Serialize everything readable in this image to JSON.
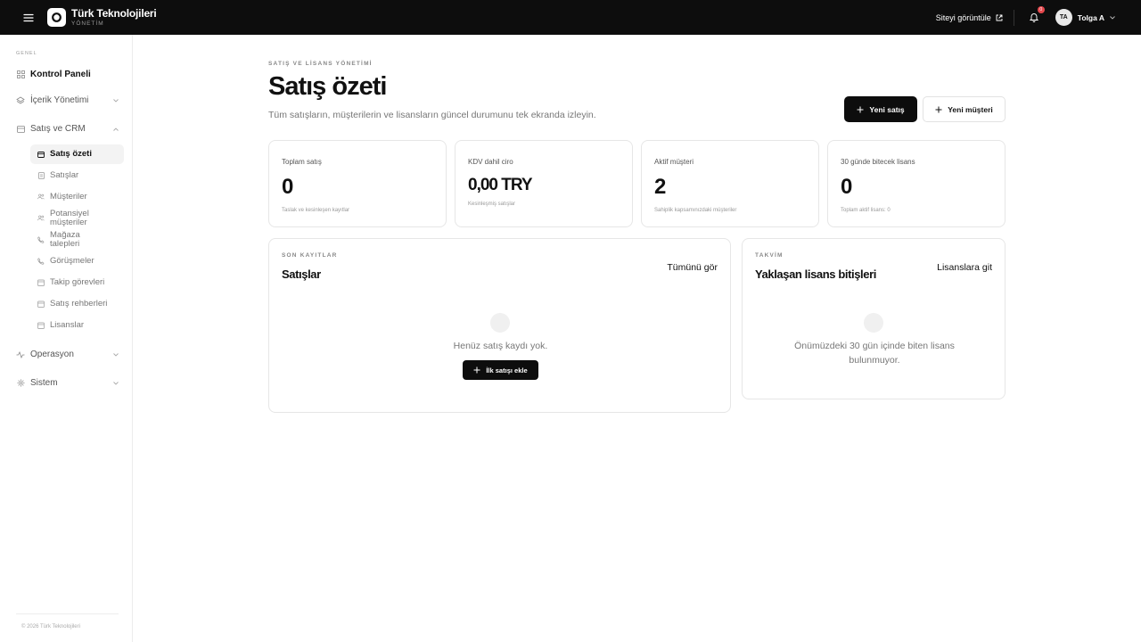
{
  "topbar": {
    "brand_name": "Türk Teknolojileri",
    "brand_sub": "YÖNETİM",
    "view_site": "Siteyi görüntüle",
    "notifications_count": "0",
    "user_initials": "TA",
    "user_name": "Tolga A"
  },
  "sidebar": {
    "section_label": "GENEL",
    "items": [
      {
        "label": "Kontrol Paneli",
        "icon": "grid-icon"
      },
      {
        "label": "İçerik Yönetimi",
        "icon": "layers-icon"
      },
      {
        "label": "Satış ve CRM",
        "icon": "wallet-icon"
      },
      {
        "label": "Operasyon",
        "icon": "activity-icon"
      },
      {
        "label": "Sistem",
        "icon": "gear-icon"
      }
    ],
    "sub_items": [
      {
        "label": "Satış özeti"
      },
      {
        "label": "Satışlar"
      },
      {
        "label": "Müşteriler"
      },
      {
        "label": "Potansiyel müşteriler"
      },
      {
        "label": "Mağaza talepleri"
      },
      {
        "label": "Görüşmeler"
      },
      {
        "label": "Takip görevleri"
      },
      {
        "label": "Satış rehberleri"
      },
      {
        "label": "Lisanslar"
      }
    ],
    "footer": "© 2026 Türk Teknolojileri"
  },
  "header": {
    "eyebrow": "SATIŞ VE LİSANS YÖNETİMİ",
    "title": "Satış özeti",
    "description": "Tüm satışların, müşterilerin ve lisansların güncel durumunu tek ekranda izleyin.",
    "new_sale": "Yeni satış",
    "new_customer": "Yeni müşteri"
  },
  "stats": [
    {
      "label": "Toplam satış",
      "value": "0",
      "sub": "Taslak ve kesinleşen kayıtlar"
    },
    {
      "label": "KDV dahil ciro",
      "value": "0,00 TRY",
      "sub": "Kesinleşmiş satışlar"
    },
    {
      "label": "Aktif müşteri",
      "value": "2",
      "sub": "Sahiplik kapsamınızdaki müşteriler"
    },
    {
      "label": "30 günde bitecek lisans",
      "value": "0",
      "sub": "Toplam aktif lisans: 0"
    }
  ],
  "sales_panel": {
    "eyebrow": "SON KAYITLAR",
    "title": "Satışlar",
    "link": "Tümünü gör",
    "empty": "Henüz satış kaydı yok.",
    "button": "İlk satışı ekle"
  },
  "license_panel": {
    "eyebrow": "TAKVİM",
    "title": "Yaklaşan lisans bitişleri",
    "link": "Lisanslara git",
    "empty_line1": "Önümüzdeki 30 gün içinde biten lisans",
    "empty_line2": "bulunmuyor."
  }
}
